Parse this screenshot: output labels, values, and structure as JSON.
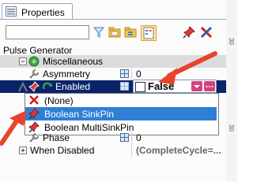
{
  "tab": {
    "label": "Properties"
  },
  "search": {
    "value": ""
  },
  "object_title": "Pulse Generator",
  "grid": {
    "category": "Miscellaneous",
    "rows": [
      {
        "name": "Asymmetry",
        "value": "0"
      },
      {
        "name": "Enabled",
        "value": "False"
      },
      {
        "name": "Phase",
        "value": "0"
      },
      {
        "name": "When Disabled",
        "value": "(CompleteCycle=..."
      }
    ]
  },
  "dropdown": {
    "options": [
      {
        "label": "(None)",
        "icon": "x-icon"
      },
      {
        "label": "Boolean SinkPin",
        "icon": "pin-icon"
      },
      {
        "label": "Boolean MultiSinkPin",
        "icon": "pin-icon"
      }
    ],
    "highlighted": 1
  },
  "ruler": {
    "ticks": [
      "30",
      "30"
    ]
  },
  "colors": {
    "selection": "#0a246a",
    "highlight": "#2f7fd6",
    "arrow": "#e8432d"
  }
}
